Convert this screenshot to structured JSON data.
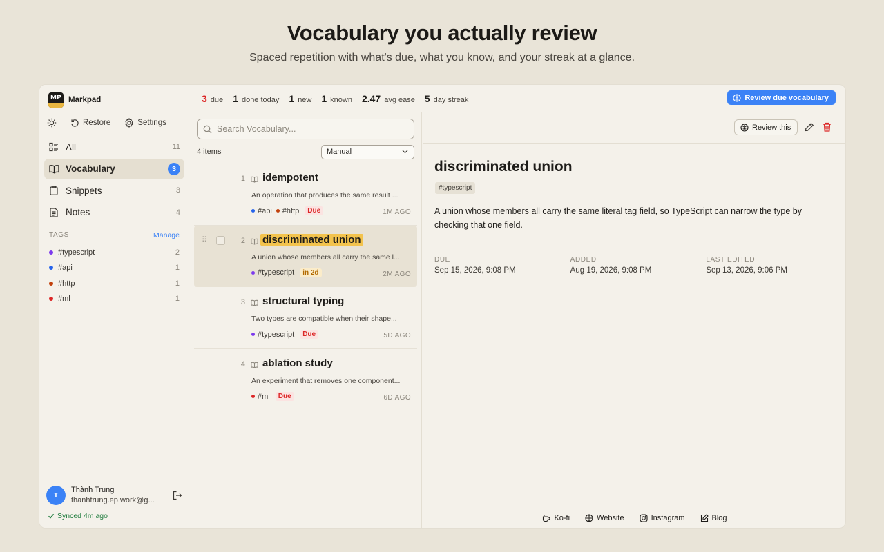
{
  "hero": {
    "title": "Vocabulary you actually review",
    "subtitle": "Spaced repetition with what's due, what you know, and your streak at a glance."
  },
  "sidebar": {
    "brand": "Markpad",
    "logo_text": "MP",
    "tools": {
      "restore": "Restore",
      "settings": "Settings"
    },
    "nav": [
      {
        "label": "All",
        "count": "11",
        "icon": "list-icon"
      },
      {
        "label": "Vocabulary",
        "count": "3",
        "icon": "book-icon",
        "active": true
      },
      {
        "label": "Snippets",
        "count": "3",
        "icon": "clipboard-icon"
      },
      {
        "label": "Notes",
        "count": "4",
        "icon": "document-icon"
      }
    ],
    "tags_heading": "TAGS",
    "manage": "Manage",
    "tags": [
      {
        "name": "#typescript",
        "count": "2",
        "color": "#7c3aed"
      },
      {
        "name": "#api",
        "count": "1",
        "color": "#2563eb"
      },
      {
        "name": "#http",
        "count": "1",
        "color": "#c2410c"
      },
      {
        "name": "#ml",
        "count": "1",
        "color": "#dc2626"
      }
    ],
    "user": {
      "initial": "T",
      "name": "Thành Trung",
      "email": "thanhtrung.ep.work@g..."
    },
    "sync": "Synced 4m ago"
  },
  "stats": [
    {
      "value": "3",
      "label": "due"
    },
    {
      "value": "1",
      "label": "done today"
    },
    {
      "value": "1",
      "label": "new"
    },
    {
      "value": "1",
      "label": "known"
    },
    {
      "value": "2.47",
      "label": "avg ease"
    },
    {
      "value": "5",
      "label": "day streak"
    }
  ],
  "review_due_button": "Review due vocabulary",
  "list": {
    "search_placeholder": "Search Vocabulary...",
    "count": "4 items",
    "sort": "Manual",
    "items": [
      {
        "num": "1",
        "word": "idempotent",
        "def": "An operation that produces the same result ...",
        "tags": [
          {
            "name": "#api",
            "color": "#2563eb"
          },
          {
            "name": "#http",
            "color": "#c2410c"
          }
        ],
        "status": "Due",
        "ago": "1M AGO"
      },
      {
        "num": "2",
        "word": "discriminated union",
        "def": "A union whose members all carry the same l...",
        "tags": [
          {
            "name": "#typescript",
            "color": "#7c3aed"
          }
        ],
        "status": "in 2d",
        "ago": "2M AGO"
      },
      {
        "num": "3",
        "word": "structural typing",
        "def": "Two types are compatible when their shape...",
        "tags": [
          {
            "name": "#typescript",
            "color": "#7c3aed"
          }
        ],
        "status": "Due",
        "ago": "5D AGO"
      },
      {
        "num": "4",
        "word": "ablation study",
        "def": "An experiment that removes one component...",
        "tags": [
          {
            "name": "#ml",
            "color": "#dc2626"
          }
        ],
        "status": "Due",
        "ago": "6D AGO"
      }
    ]
  },
  "detail": {
    "review_this": "Review this",
    "title": "discriminated union",
    "tag": "#typescript",
    "definition": "A union whose members all carry the same literal tag field, so TypeScript can narrow the type by checking that one field.",
    "fields": [
      {
        "key": "DUE",
        "value": "Sep 15, 2026, 9:08 PM"
      },
      {
        "key": "ADDED",
        "value": "Aug 19, 2026, 9:08 PM"
      },
      {
        "key": "LAST EDITED",
        "value": "Sep 13, 2026, 9:06 PM"
      }
    ]
  },
  "footer": [
    {
      "label": "Ko-fi",
      "icon": "coffee-icon"
    },
    {
      "label": "Website",
      "icon": "globe-icon"
    },
    {
      "label": "Instagram",
      "icon": "instagram-icon"
    },
    {
      "label": "Blog",
      "icon": "edit-icon"
    }
  ],
  "colors": {
    "accent": "#3b82f6",
    "due_red": "#dc2626",
    "highlight": "#f3c34d",
    "background": "#e9e4d8",
    "panel": "#f4f1ea"
  }
}
